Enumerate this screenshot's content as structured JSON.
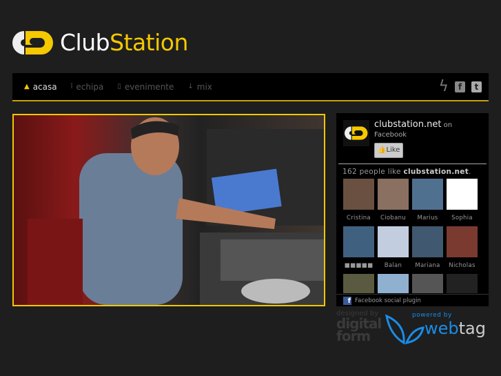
{
  "header": {
    "brand_part1": "Club",
    "brand_part2": "Station",
    "accent": "#f5c800"
  },
  "nav": {
    "items": [
      {
        "label": "acasa",
        "icon": "home-icon",
        "active": true
      },
      {
        "label": "echipa",
        "icon": "person-icon"
      },
      {
        "label": "evenimente",
        "icon": "ticket-icon"
      },
      {
        "label": "mix",
        "icon": "download-icon"
      }
    ],
    "social": [
      "bolt-icon",
      "facebook-icon",
      "twitter-icon"
    ]
  },
  "facebook": {
    "page_name": "clubstation.net",
    "on": "on",
    "facebook": "Facebook",
    "like_label": "Like",
    "count_text": "162 people like",
    "count_page": "clubstation.net",
    "period": ".",
    "friends": [
      {
        "name": "Cristina",
        "color": "#6a5040"
      },
      {
        "name": "Ciobanu",
        "color": "#8a7060"
      },
      {
        "name": "Marius",
        "color": "#507090"
      },
      {
        "name": "Sophia",
        "color": "#ffffff"
      },
      {
        "name": "■■■■■",
        "color": "#406080"
      },
      {
        "name": "Balan",
        "color": "#c3cde0"
      },
      {
        "name": "Mariana",
        "color": "#405870"
      },
      {
        "name": "Nicholas",
        "color": "#7a3a30"
      },
      {
        "name": "",
        "color": "#5a5a40"
      },
      {
        "name": "",
        "color": "#90b0d0"
      },
      {
        "name": "",
        "color": "#555"
      },
      {
        "name": "",
        "color": "#222"
      }
    ],
    "footer": "Facebook social plugin"
  },
  "credits": {
    "designed_by": "designed by",
    "designer": "digital form",
    "powered_by": "powered by",
    "web": "web",
    "tag": "tag"
  }
}
